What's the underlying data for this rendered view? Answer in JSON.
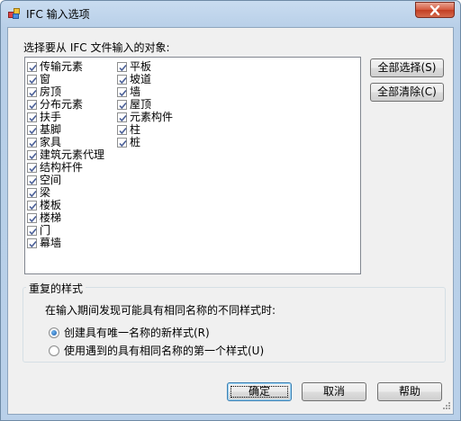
{
  "window": {
    "title": "IFC 输入选项",
    "close_icon": "close-icon"
  },
  "objects": {
    "label": "选择要从 IFC 文件输入的对象:",
    "column1": [
      {
        "label": "传输元素",
        "checked": true
      },
      {
        "label": "窗",
        "checked": true
      },
      {
        "label": "房顶",
        "checked": true
      },
      {
        "label": "分布元素",
        "checked": true
      },
      {
        "label": "扶手",
        "checked": true
      },
      {
        "label": "基脚",
        "checked": true
      },
      {
        "label": "家具",
        "checked": true
      },
      {
        "label": "建筑元素代理",
        "checked": true
      },
      {
        "label": "结构杆件",
        "checked": true
      },
      {
        "label": "空间",
        "checked": true
      },
      {
        "label": "梁",
        "checked": true
      },
      {
        "label": "楼板",
        "checked": true
      },
      {
        "label": "楼梯",
        "checked": true
      },
      {
        "label": "门",
        "checked": true
      },
      {
        "label": "幕墙",
        "checked": true
      }
    ],
    "column2": [
      {
        "label": "平板",
        "checked": true
      },
      {
        "label": "坡道",
        "checked": true
      },
      {
        "label": "墙",
        "checked": true
      },
      {
        "label": "屋顶",
        "checked": true
      },
      {
        "label": "元素构件",
        "checked": true
      },
      {
        "label": "柱",
        "checked": true
      },
      {
        "label": "桩",
        "checked": true
      }
    ],
    "select_all_label": "全部选择(S)",
    "clear_all_label": "全部清除(C)"
  },
  "duplicate_styles": {
    "title": "重复的样式",
    "prompt": "在输入期间发现可能具有相同名称的不同样式时:",
    "options": [
      {
        "label": "创建具有唯一名称的新样式(R)",
        "checked": true
      },
      {
        "label": "使用遇到的具有相同名称的第一个样式(U)",
        "checked": false
      }
    ]
  },
  "footer": {
    "ok_label": "确定",
    "cancel_label": "取消",
    "help_label": "帮助"
  }
}
